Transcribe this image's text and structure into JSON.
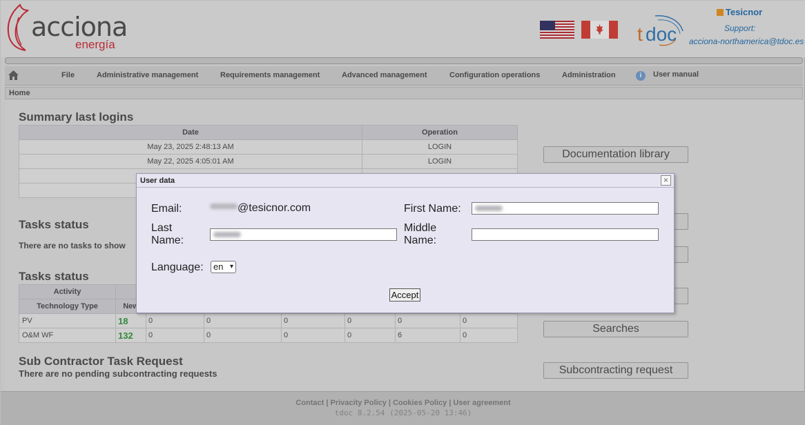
{
  "header": {
    "brand": "acciona",
    "brand_sub": "energía",
    "tesicnor": "Tesicnor",
    "support_label": "Support:",
    "support_email": "acciona-northamerica@tdoc.es",
    "tdoc": "tdoc"
  },
  "menu": {
    "items": [
      "File",
      "Administrative management",
      "Requirements management",
      "Advanced management",
      "Configuration operations",
      "Administration",
      "User manual"
    ]
  },
  "breadcrumb": "Home",
  "logins": {
    "title": "Summary last logins",
    "headers": [
      "Date",
      "Operation"
    ],
    "rows": [
      [
        "May 23, 2025 2:48:13 AM",
        "LOGIN"
      ],
      [
        "May 22, 2025 4:05:01 AM",
        "LOGIN"
      ]
    ]
  },
  "tasks_status_1": {
    "title": "Tasks status",
    "note": "There are no tasks to show"
  },
  "tasks_status_2": {
    "title": "Tasks status",
    "header_activity": "Activity",
    "header_tech": "Technology Type",
    "header_new": "New",
    "rows": [
      {
        "type": "PV",
        "new": "18",
        "c1": "0",
        "c2": "0",
        "c3": "0",
        "c4": "0",
        "c5": "0",
        "c6": "0"
      },
      {
        "type": "O&M WF",
        "new": "132",
        "c1": "0",
        "c2": "0",
        "c3": "0",
        "c4": "0",
        "c5": "6",
        "c6": "0"
      }
    ]
  },
  "subcontract": {
    "title": "Sub Contractor Task Request",
    "note": "There are no pending subcontracting requests"
  },
  "side_buttons": {
    "doc_library": "Documentation library",
    "searches": "Searches",
    "subcontracting": "Subcontracting request"
  },
  "footer": {
    "links": "Contact | Privacity Policy | Cookies Policy | User agreement",
    "version": "tdoc 8.2.54 (2025-05-20 13:46)"
  },
  "dialog": {
    "title": "User data",
    "email_label": "Email:",
    "email_domain": "@tesicnor.com",
    "first_name_label": "First Name:",
    "last_name_label_1": "Last",
    "last_name_label_2": "Name:",
    "middle_name_label_1": "Middle",
    "middle_name_label_2": "Name:",
    "middle_name_value": "",
    "language_label": "Language:",
    "language_value": "en",
    "accept_label": "Accept"
  }
}
